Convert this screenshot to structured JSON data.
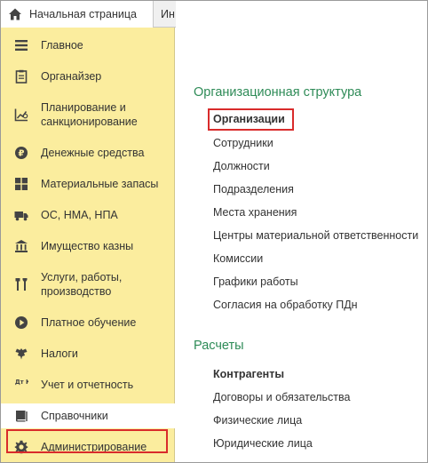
{
  "tabs": {
    "home_label": "Начальная страница",
    "next_label_partial": "Ин"
  },
  "sidebar": {
    "items": [
      {
        "label": "Главное",
        "icon": "menu-lines-icon"
      },
      {
        "label": "Органайзер",
        "icon": "clipboard-icon"
      },
      {
        "label": "Планирование и санкционирование",
        "icon": "chart-growth-icon"
      },
      {
        "label": "Денежные средства",
        "icon": "coin-icon"
      },
      {
        "label": "Материальные запасы",
        "icon": "grid-icon"
      },
      {
        "label": "ОС, НМА, НПА",
        "icon": "truck-icon"
      },
      {
        "label": "Имущество казны",
        "icon": "building-icon"
      },
      {
        "label": "Услуги, работы, производство",
        "icon": "tools-icon"
      },
      {
        "label": "Платное обучение",
        "icon": "play-circle-icon"
      },
      {
        "label": "Налоги",
        "icon": "eagle-icon"
      },
      {
        "label": "Учет и отчетность",
        "icon": "dt-kt-icon",
        "icon_text": "Дт Кт"
      },
      {
        "label": "Справочники",
        "icon": "book-icon"
      },
      {
        "label": "Администрирование",
        "icon": "gear-icon"
      }
    ],
    "selected_index": 11
  },
  "content": {
    "sections": [
      {
        "title": "Организационная структура",
        "links": [
          {
            "label": "Организации",
            "bold": true,
            "highlighted": true
          },
          {
            "label": "Сотрудники"
          },
          {
            "label": "Должности"
          },
          {
            "label": "Подразделения"
          },
          {
            "label": "Места хранения"
          },
          {
            "label": "Центры материальной ответственности"
          },
          {
            "label": "Комиссии"
          },
          {
            "label": "Графики работы"
          },
          {
            "label": "Согласия на обработку ПДн"
          }
        ]
      },
      {
        "title": "Расчеты",
        "links": [
          {
            "label": "Контрагенты",
            "bold": true
          },
          {
            "label": "Договоры и обязательства"
          },
          {
            "label": "Физические лица"
          },
          {
            "label": "Юридические лица"
          }
        ]
      }
    ]
  },
  "colors": {
    "sidebar_bg": "#fbed9e",
    "section_title": "#2e8b57",
    "highlight_border": "#d92b2b",
    "icon": "#444444"
  }
}
